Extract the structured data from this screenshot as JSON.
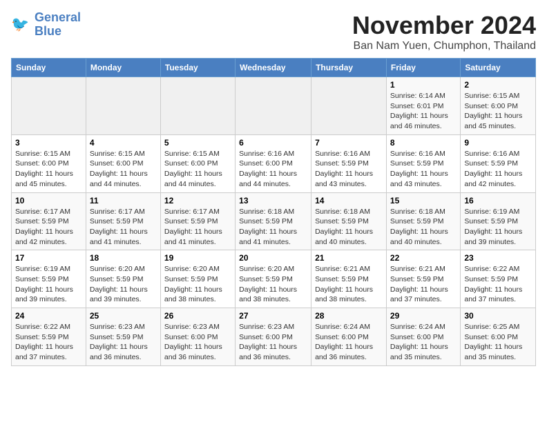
{
  "header": {
    "logo_line1": "General",
    "logo_line2": "Blue",
    "title": "November 2024",
    "subtitle": "Ban Nam Yuen, Chumphon, Thailand"
  },
  "weekdays": [
    "Sunday",
    "Monday",
    "Tuesday",
    "Wednesday",
    "Thursday",
    "Friday",
    "Saturday"
  ],
  "weeks": [
    [
      {
        "day": "",
        "info": ""
      },
      {
        "day": "",
        "info": ""
      },
      {
        "day": "",
        "info": ""
      },
      {
        "day": "",
        "info": ""
      },
      {
        "day": "",
        "info": ""
      },
      {
        "day": "1",
        "info": "Sunrise: 6:14 AM\nSunset: 6:01 PM\nDaylight: 11 hours\nand 46 minutes."
      },
      {
        "day": "2",
        "info": "Sunrise: 6:15 AM\nSunset: 6:00 PM\nDaylight: 11 hours\nand 45 minutes."
      }
    ],
    [
      {
        "day": "3",
        "info": "Sunrise: 6:15 AM\nSunset: 6:00 PM\nDaylight: 11 hours\nand 45 minutes."
      },
      {
        "day": "4",
        "info": "Sunrise: 6:15 AM\nSunset: 6:00 PM\nDaylight: 11 hours\nand 44 minutes."
      },
      {
        "day": "5",
        "info": "Sunrise: 6:15 AM\nSunset: 6:00 PM\nDaylight: 11 hours\nand 44 minutes."
      },
      {
        "day": "6",
        "info": "Sunrise: 6:16 AM\nSunset: 6:00 PM\nDaylight: 11 hours\nand 44 minutes."
      },
      {
        "day": "7",
        "info": "Sunrise: 6:16 AM\nSunset: 5:59 PM\nDaylight: 11 hours\nand 43 minutes."
      },
      {
        "day": "8",
        "info": "Sunrise: 6:16 AM\nSunset: 5:59 PM\nDaylight: 11 hours\nand 43 minutes."
      },
      {
        "day": "9",
        "info": "Sunrise: 6:16 AM\nSunset: 5:59 PM\nDaylight: 11 hours\nand 42 minutes."
      }
    ],
    [
      {
        "day": "10",
        "info": "Sunrise: 6:17 AM\nSunset: 5:59 PM\nDaylight: 11 hours\nand 42 minutes."
      },
      {
        "day": "11",
        "info": "Sunrise: 6:17 AM\nSunset: 5:59 PM\nDaylight: 11 hours\nand 41 minutes."
      },
      {
        "day": "12",
        "info": "Sunrise: 6:17 AM\nSunset: 5:59 PM\nDaylight: 11 hours\nand 41 minutes."
      },
      {
        "day": "13",
        "info": "Sunrise: 6:18 AM\nSunset: 5:59 PM\nDaylight: 11 hours\nand 41 minutes."
      },
      {
        "day": "14",
        "info": "Sunrise: 6:18 AM\nSunset: 5:59 PM\nDaylight: 11 hours\nand 40 minutes."
      },
      {
        "day": "15",
        "info": "Sunrise: 6:18 AM\nSunset: 5:59 PM\nDaylight: 11 hours\nand 40 minutes."
      },
      {
        "day": "16",
        "info": "Sunrise: 6:19 AM\nSunset: 5:59 PM\nDaylight: 11 hours\nand 39 minutes."
      }
    ],
    [
      {
        "day": "17",
        "info": "Sunrise: 6:19 AM\nSunset: 5:59 PM\nDaylight: 11 hours\nand 39 minutes."
      },
      {
        "day": "18",
        "info": "Sunrise: 6:20 AM\nSunset: 5:59 PM\nDaylight: 11 hours\nand 39 minutes."
      },
      {
        "day": "19",
        "info": "Sunrise: 6:20 AM\nSunset: 5:59 PM\nDaylight: 11 hours\nand 38 minutes."
      },
      {
        "day": "20",
        "info": "Sunrise: 6:20 AM\nSunset: 5:59 PM\nDaylight: 11 hours\nand 38 minutes."
      },
      {
        "day": "21",
        "info": "Sunrise: 6:21 AM\nSunset: 5:59 PM\nDaylight: 11 hours\nand 38 minutes."
      },
      {
        "day": "22",
        "info": "Sunrise: 6:21 AM\nSunset: 5:59 PM\nDaylight: 11 hours\nand 37 minutes."
      },
      {
        "day": "23",
        "info": "Sunrise: 6:22 AM\nSunset: 5:59 PM\nDaylight: 11 hours\nand 37 minutes."
      }
    ],
    [
      {
        "day": "24",
        "info": "Sunrise: 6:22 AM\nSunset: 5:59 PM\nDaylight: 11 hours\nand 37 minutes."
      },
      {
        "day": "25",
        "info": "Sunrise: 6:23 AM\nSunset: 5:59 PM\nDaylight: 11 hours\nand 36 minutes."
      },
      {
        "day": "26",
        "info": "Sunrise: 6:23 AM\nSunset: 6:00 PM\nDaylight: 11 hours\nand 36 minutes."
      },
      {
        "day": "27",
        "info": "Sunrise: 6:23 AM\nSunset: 6:00 PM\nDaylight: 11 hours\nand 36 minutes."
      },
      {
        "day": "28",
        "info": "Sunrise: 6:24 AM\nSunset: 6:00 PM\nDaylight: 11 hours\nand 36 minutes."
      },
      {
        "day": "29",
        "info": "Sunrise: 6:24 AM\nSunset: 6:00 PM\nDaylight: 11 hours\nand 35 minutes."
      },
      {
        "day": "30",
        "info": "Sunrise: 6:25 AM\nSunset: 6:00 PM\nDaylight: 11 hours\nand 35 minutes."
      }
    ]
  ]
}
